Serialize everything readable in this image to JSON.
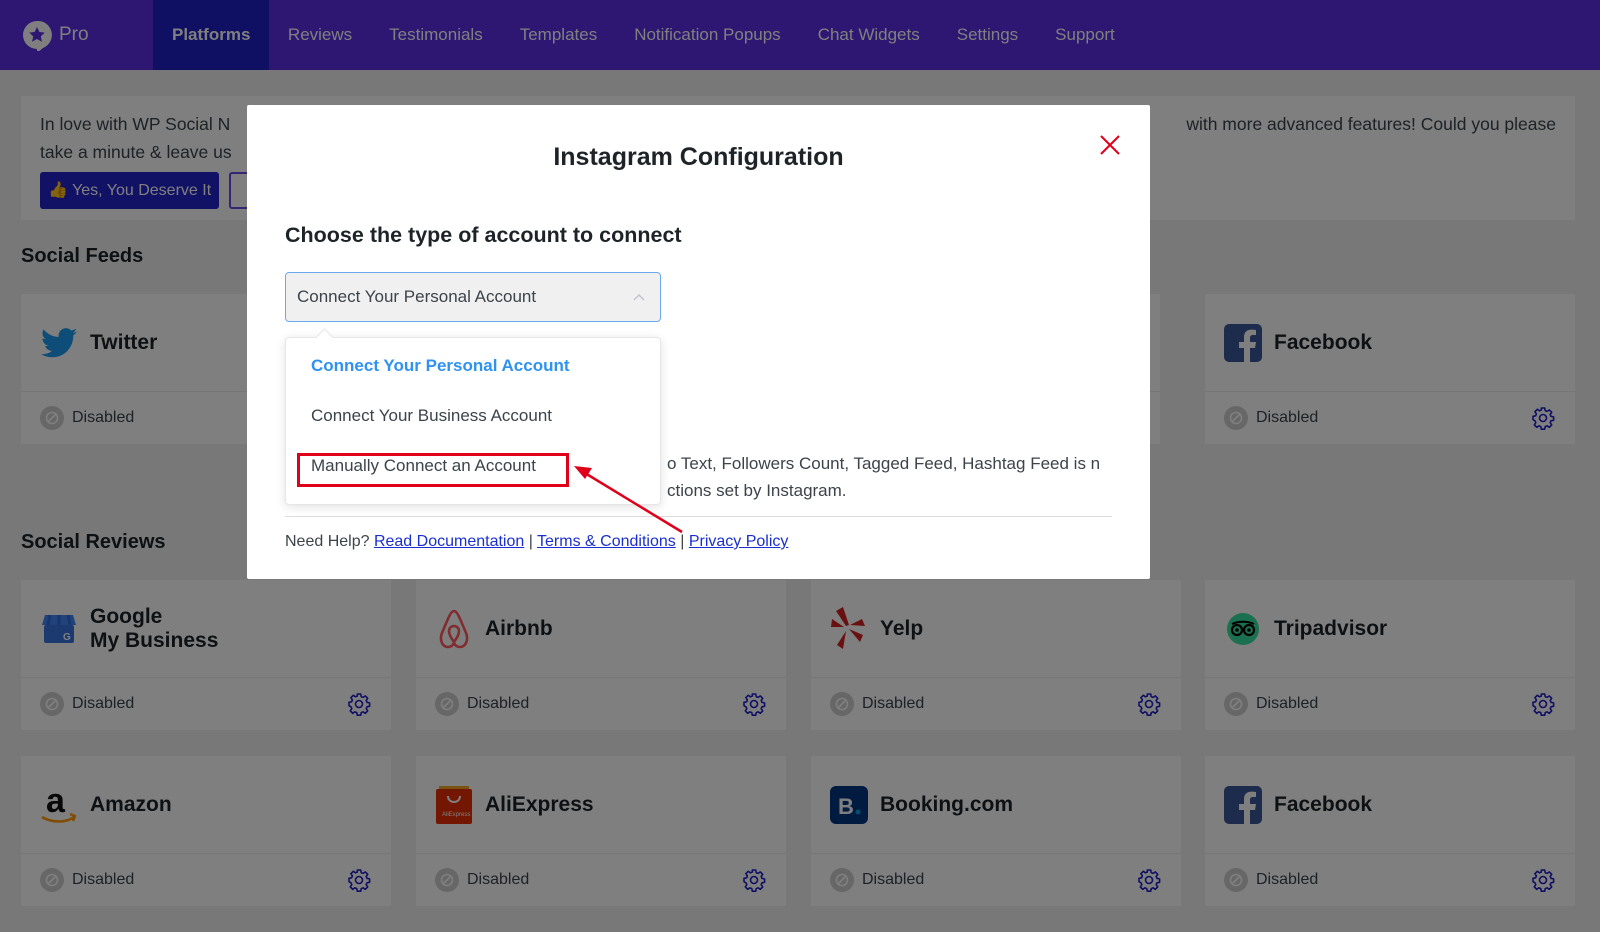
{
  "brand": {
    "name": "Pro",
    "logo_icon": "star-chat-icon"
  },
  "nav": {
    "items": [
      {
        "label": "Platforms",
        "active": true
      },
      {
        "label": "Reviews",
        "active": false
      },
      {
        "label": "Testimonials",
        "active": false
      },
      {
        "label": "Templates",
        "active": false
      },
      {
        "label": "Notification Popups",
        "active": false
      },
      {
        "label": "Chat Widgets",
        "active": false
      },
      {
        "label": "Settings",
        "active": false
      },
      {
        "label": "Support",
        "active": false
      }
    ]
  },
  "notice": {
    "line1_left": "In love with WP Social N",
    "line1_right": "with more advanced features! Could you please",
    "line2_left": "take a minute & leave us",
    "yes_button": "👍 Yes, You Deserve It"
  },
  "sections": {
    "feeds_title": "Social Feeds",
    "reviews_title": "Social Reviews"
  },
  "feed_cards": [
    {
      "name": "Twitter",
      "icon": "twitter-icon",
      "status": "Disabled"
    },
    {
      "name": "Facebook",
      "icon": "facebook-icon",
      "status": "Disabled"
    }
  ],
  "review_cards": [
    {
      "name_line1": "Google",
      "name_line2": "My Business",
      "icon": "google-my-business-icon",
      "status": "Disabled"
    },
    {
      "name": "Airbnb",
      "icon": "airbnb-icon",
      "status": "Disabled"
    },
    {
      "name": "Yelp",
      "icon": "yelp-icon",
      "status": "Disabled"
    },
    {
      "name": "Tripadvisor",
      "icon": "tripadvisor-icon",
      "status": "Disabled"
    },
    {
      "name": "Amazon",
      "icon": "amazon-icon",
      "status": "Disabled"
    },
    {
      "name": "AliExpress",
      "icon": "aliexpress-icon",
      "status": "Disabled"
    },
    {
      "name": "Booking.com",
      "icon": "booking-icon",
      "status": "Disabled"
    },
    {
      "name": "Facebook",
      "icon": "facebook-icon",
      "status": "Disabled"
    }
  ],
  "modal": {
    "title": "Instagram Configuration",
    "subtitle": "Choose the type of account to connect",
    "select_value": "Connect Your Personal Account",
    "options": [
      {
        "label": "Connect Your Personal Account",
        "selected": true
      },
      {
        "label": "Connect Your Business Account",
        "selected": false
      },
      {
        "label": "Manually Connect an Account",
        "selected": false,
        "highlighted": true
      }
    ],
    "note_line1": "o Text, Followers Count, Tagged Feed, Hashtag Feed is n",
    "note_line2": "ctions set by Instagram.",
    "footer": {
      "need_help": "Need Help?",
      "doc_link": "Read Documentation",
      "terms_link": "Terms & Conditions",
      "privacy_link": "Privacy Policy",
      "separator": "|"
    }
  },
  "colors": {
    "nav_bg": "#5a2ee6",
    "nav_active": "#1e1ec8",
    "selected_option": "#2e93f0",
    "highlight": "#e0001a",
    "link": "#1a2fcf",
    "gear": "#1e1ec8"
  }
}
